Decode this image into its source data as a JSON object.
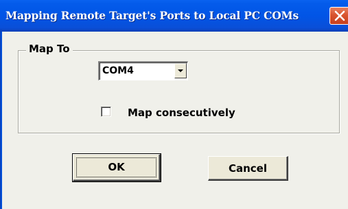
{
  "window": {
    "title": "Mapping Remote Target's Ports to Local PC COMs",
    "close_icon": "close-x-icon"
  },
  "group": {
    "label": "Map To"
  },
  "combo": {
    "selected": "COM4",
    "arrow_icon": "dropdown-arrow-icon"
  },
  "checkbox": {
    "label": "Map consecutively",
    "checked": false
  },
  "buttons": {
    "ok": "OK",
    "cancel": "Cancel"
  },
  "colors": {
    "titlebar": "#0155e6",
    "close": "#d9542e",
    "dialog_bg": "#f0f0ea"
  }
}
